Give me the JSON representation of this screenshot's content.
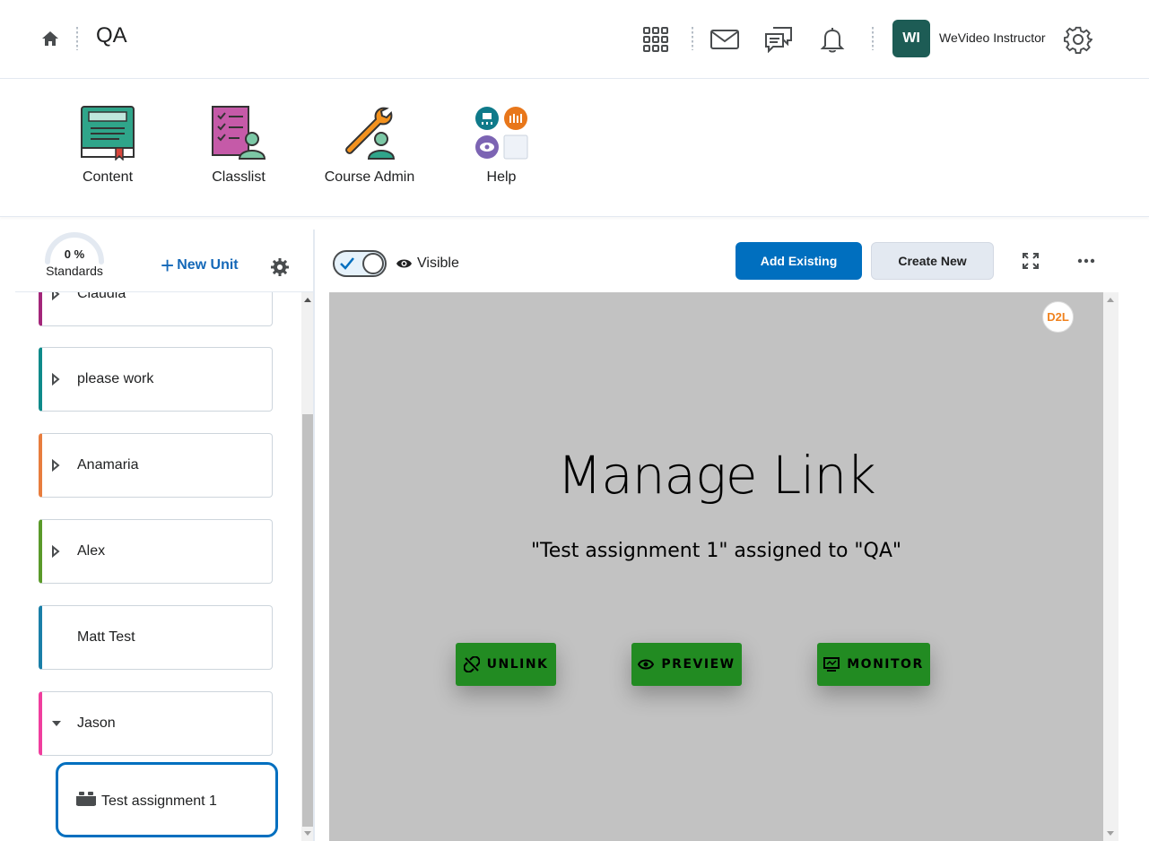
{
  "header": {
    "course_title": "QA",
    "user_initials": "WI",
    "user_name": "WeVideo Instructor",
    "avatar_color": "#1d5c55"
  },
  "navbar": {
    "items": [
      {
        "label": "Content",
        "icon": "content-book-icon"
      },
      {
        "label": "Classlist",
        "icon": "classlist-icon"
      },
      {
        "label": "Course Admin",
        "icon": "wrench-admin-icon"
      },
      {
        "label": "Help",
        "icon": "help-grid-icon"
      }
    ]
  },
  "left_panel": {
    "standards_pct": "0 %",
    "standards_label": "Standards",
    "new_unit_label": "New Unit",
    "units": [
      {
        "label": "Claudia",
        "color": "#a3267a",
        "expandable": true
      },
      {
        "label": "please work",
        "color": "#0e8a8a",
        "expandable": true
      },
      {
        "label": "Anamaria",
        "color": "#e87d3e",
        "expandable": true
      },
      {
        "label": "Alex",
        "color": "#5a9a2a",
        "expandable": true
      },
      {
        "label": "Matt Test",
        "color": "#1a7fa8",
        "expandable": false
      },
      {
        "label": "Jason",
        "color": "#f03e9e",
        "expandable": true,
        "expanded": true
      }
    ],
    "lesson": {
      "label": "Test assignment 1",
      "icon": "lego-brick-icon"
    }
  },
  "toolbar": {
    "visible_label": "Visible",
    "add_existing_label": "Add Existing",
    "create_new_label": "Create New",
    "accent": "#006fbf"
  },
  "content": {
    "badge_text": "D2L",
    "title": "Manage Link",
    "subtitle": "\"Test assignment 1\" assigned to \"QA\"",
    "buttons": {
      "unlink": "UNLINK",
      "preview": "PREVIEW",
      "monitor": "MONITOR"
    },
    "button_color": "#228b22"
  }
}
